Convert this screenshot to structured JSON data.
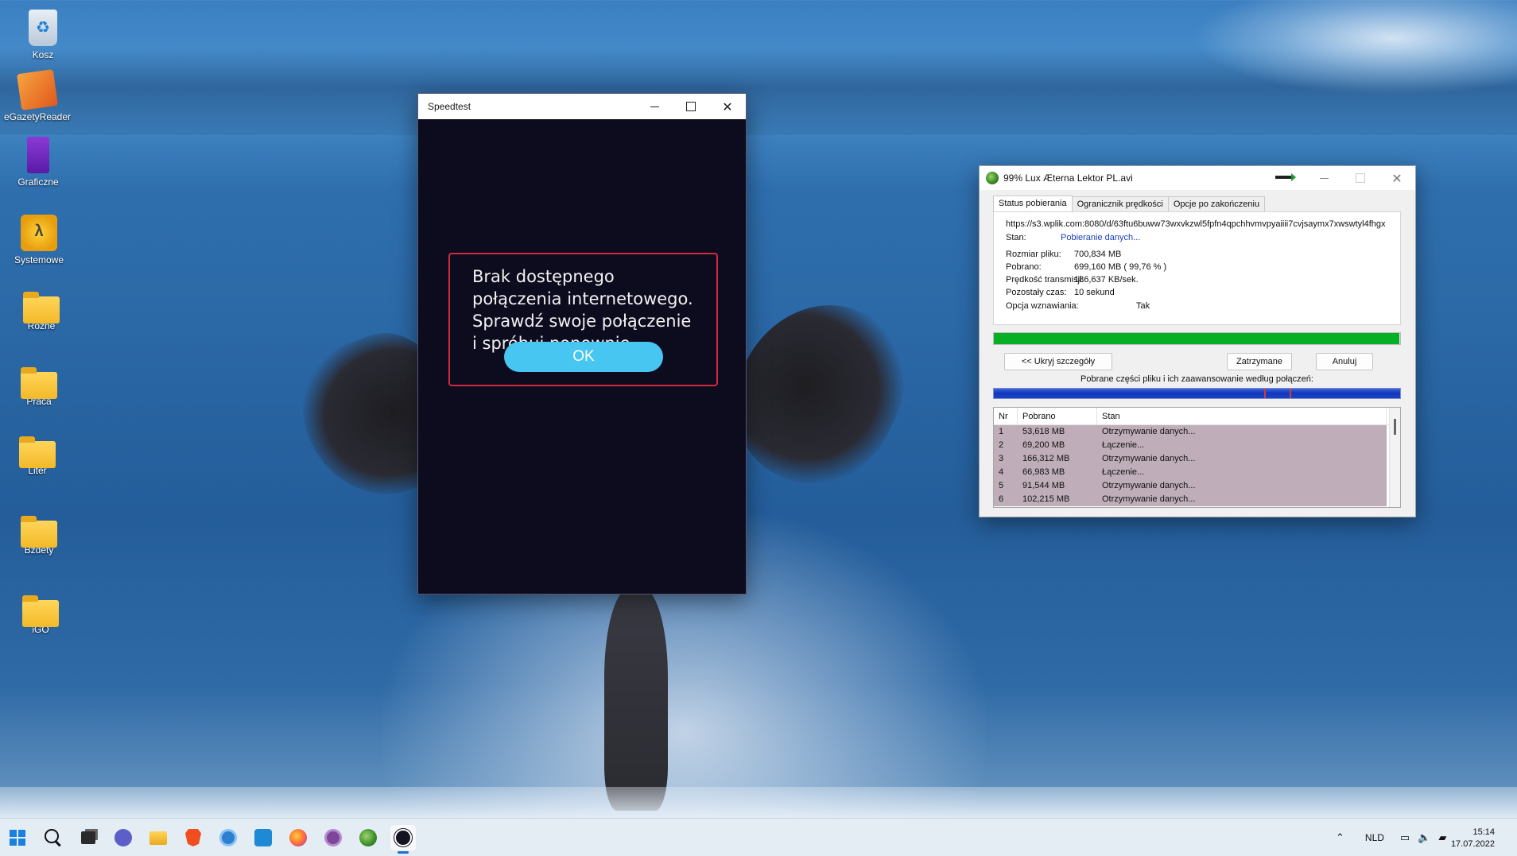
{
  "desktop": {
    "icons": [
      {
        "label": "Kosz",
        "icon": "recycle-bin-icon"
      },
      {
        "label": "eGazetyReader",
        "icon": "egazety-reader-icon"
      },
      {
        "label": "Graficzne",
        "icon": "purple-book-icon"
      },
      {
        "label": "Systemowe",
        "icon": "system-folder-icon"
      },
      {
        "label": "Rozne",
        "icon": "folder-icon"
      },
      {
        "label": "Praca",
        "icon": "folder-icon"
      },
      {
        "label": "Liter",
        "icon": "folder-icon"
      },
      {
        "label": "Bzdety",
        "icon": "folder-icon"
      },
      {
        "label": "iGO",
        "icon": "folder-icon"
      }
    ]
  },
  "speedtest": {
    "title": "Speedtest",
    "message": "Brak dostępnego połączenia internetowego. Sprawdź swoje połączenie i spróbuj ponownie.",
    "ok_label": "OK",
    "colors": {
      "background": "#0d0b1e",
      "border": "#d1293f",
      "button": "#47c6f2"
    }
  },
  "idm": {
    "title": "99% Lux Æterna Lektor PL.avi",
    "tabs": [
      "Status pobierania",
      "Ogranicznik prędkości",
      "Opcje po zakończeniu"
    ],
    "url": "https://s3.wplik.com:8080/d/63ftu6buww73wxvkzwl5fpfn4qpchhvmvpyaiiii7cvjsaymx7xwswtyl4fhgx",
    "status_label": "Stan:",
    "status_value": "Pobieranie danych...",
    "fields": [
      {
        "label": "Rozmiar pliku:",
        "value": "700,834  MB"
      },
      {
        "label": "Pobrano:",
        "value": "699,160  MB  ( 99,76 % )"
      },
      {
        "label": "Prędkość transmisji:",
        "value": "186,637  KB/sek."
      },
      {
        "label": "Pozostały czas:",
        "value": "10 sekund"
      },
      {
        "label": "Opcja wznawiania:",
        "value": "Tak"
      }
    ],
    "progress_fraction": 0.9976,
    "buttons": {
      "hide_details": "<< Ukryj szczegóły",
      "pause": "Zatrzymane",
      "cancel": "Anuluj"
    },
    "parts_label": "Pobrane części pliku i ich zaawansowanie według połączeń:",
    "columns": [
      "Nr",
      "Pobrano",
      "Stan"
    ],
    "rows": [
      {
        "nr": "1",
        "pobrano": "53,618  MB",
        "stan": "Otrzymywanie danych..."
      },
      {
        "nr": "2",
        "pobrano": "69,200  MB",
        "stan": "Łączenie..."
      },
      {
        "nr": "3",
        "pobrano": "166,312  MB",
        "stan": "Otrzymywanie danych..."
      },
      {
        "nr": "4",
        "pobrano": "66,983  MB",
        "stan": "Łączenie..."
      },
      {
        "nr": "5",
        "pobrano": "91,544  MB",
        "stan": "Otrzymywanie danych..."
      },
      {
        "nr": "6",
        "pobrano": "102,215  MB",
        "stan": "Otrzymywanie danych..."
      }
    ],
    "colors": {
      "progress": "#06b025",
      "row": "#bfaeb9"
    }
  },
  "taskbar": {
    "apps": [
      "start-icon",
      "search-icon",
      "task-view-icon",
      "teams-chat-icon",
      "file-explorer-icon",
      "brave-icon",
      "vpn-icon",
      "app-icon",
      "firefox-icon",
      "tor-icon",
      "idm-icon",
      "speedtest-icon"
    ],
    "language": "NLD",
    "time": "15:14",
    "date": "17.07.2022"
  }
}
